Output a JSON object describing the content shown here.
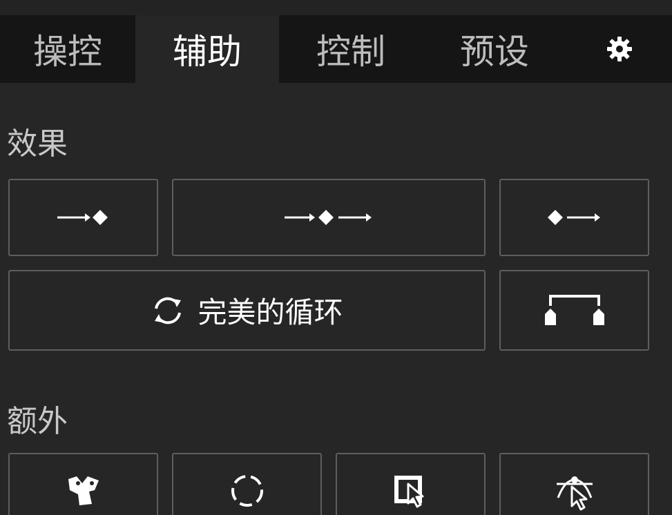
{
  "tabs": [
    {
      "label": "操控"
    },
    {
      "label": "辅助"
    },
    {
      "label": "控制"
    },
    {
      "label": "预设"
    }
  ],
  "active_tab": "辅助",
  "settings_icon": "gear-icon",
  "sections": {
    "effects": {
      "title": "效果",
      "buttons": [
        {
          "icon": "ease-in-keyframe-icon"
        },
        {
          "icon": "ease-in-out-keyframe-icon"
        },
        {
          "icon": "ease-out-keyframe-icon"
        },
        {
          "icon": "loop-icon",
          "label": "完美的循环"
        },
        {
          "icon": "bracket-markers-icon"
        }
      ]
    },
    "extra": {
      "title": "额外",
      "buttons": [
        {
          "icon": "puppet-shape-icon"
        },
        {
          "icon": "dashed-circle-icon"
        },
        {
          "icon": "select-layer-cursor-icon"
        },
        {
          "icon": "anchor-cursor-icon"
        }
      ]
    }
  },
  "colors": {
    "background": "#262626",
    "tabbar": "#151515",
    "border": "#5e5e5e",
    "text": "#ffffff"
  }
}
